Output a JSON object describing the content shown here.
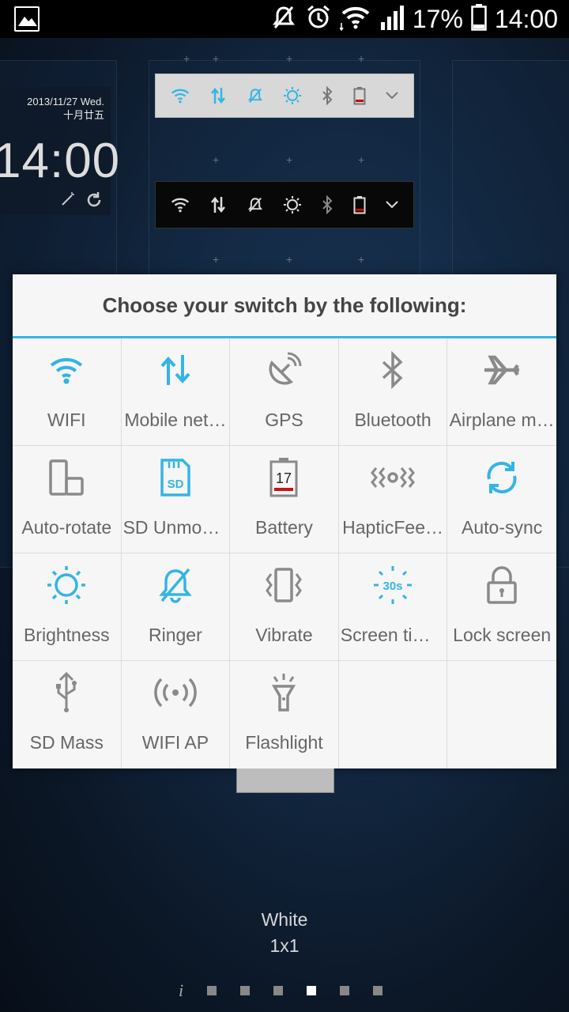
{
  "status_bar": {
    "battery_percent": "17%",
    "time": "14:00",
    "icons": [
      "gallery-icon",
      "mute-icon",
      "alarm-icon",
      "wifi-icon",
      "signal-icon",
      "battery-icon"
    ]
  },
  "clock_widget": {
    "date": "2013/11/27  Wed.",
    "lunar_date": "十月廿五",
    "time": "14:00"
  },
  "dialog": {
    "title": "Choose your switch by the following:",
    "accent_color": "#33b5e5",
    "switches": [
      {
        "label": "WIFI",
        "icon": "wifi-icon",
        "active": true
      },
      {
        "label": "Mobile net…",
        "icon": "mobile-data-icon",
        "active": true
      },
      {
        "label": "GPS",
        "icon": "gps-icon",
        "active": false
      },
      {
        "label": "Bluetooth",
        "icon": "bluetooth-icon",
        "active": false
      },
      {
        "label": "Airplane m…",
        "icon": "airplane-icon",
        "active": false
      },
      {
        "label": "Auto-rotate",
        "icon": "auto-rotate-icon",
        "active": false
      },
      {
        "label": "SD Unmou…",
        "icon": "sd-card-icon",
        "active": true
      },
      {
        "label": "Battery",
        "icon": "battery-icon",
        "active": false,
        "value": "17"
      },
      {
        "label": "HapticFee…",
        "icon": "haptic-icon",
        "active": false
      },
      {
        "label": "Auto-sync",
        "icon": "sync-icon",
        "active": true
      },
      {
        "label": "Brightness",
        "icon": "brightness-icon",
        "active": true
      },
      {
        "label": "Ringer",
        "icon": "ringer-icon",
        "active": true
      },
      {
        "label": "Vibrate",
        "icon": "vibrate-icon",
        "active": false
      },
      {
        "label": "Screen tim…",
        "icon": "screen-timeout-icon",
        "active": true,
        "value": "30s"
      },
      {
        "label": "Lock screen",
        "icon": "lock-icon",
        "active": false
      },
      {
        "label": "SD Mass",
        "icon": "usb-icon",
        "active": false
      },
      {
        "label": "WIFI AP",
        "icon": "hotspot-icon",
        "active": false
      },
      {
        "label": "Flashlight",
        "icon": "flashlight-icon",
        "active": false
      },
      {
        "label": "",
        "icon": "",
        "active": false
      },
      {
        "label": "",
        "icon": "",
        "active": false
      }
    ]
  },
  "widget": {
    "name": "White",
    "size": "1x1"
  },
  "pager": {
    "info": "i",
    "page_count": 6,
    "active_index": 3
  }
}
